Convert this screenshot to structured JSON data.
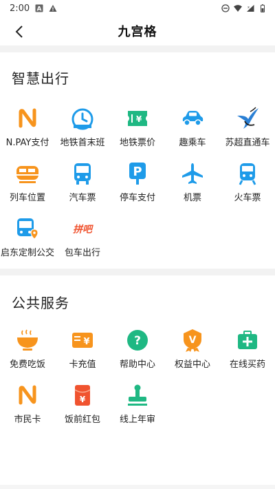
{
  "status_bar": {
    "time": "2:00"
  },
  "header": {
    "title": "九宫格"
  },
  "sections": [
    {
      "title": "智慧出行",
      "items": [
        {
          "label": "N.PAY支付",
          "icon": "npay-icon"
        },
        {
          "label": "地铁首末班",
          "icon": "subway-clock-icon"
        },
        {
          "label": "地铁票价",
          "icon": "subway-ticket-icon"
        },
        {
          "label": "趣乘车",
          "icon": "car-icon"
        },
        {
          "label": "苏超直通车",
          "icon": "swallow-logo-icon"
        },
        {
          "label": "列车位置",
          "icon": "train-location-icon"
        },
        {
          "label": "汽车票",
          "icon": "bus-ticket-icon"
        },
        {
          "label": "停车支付",
          "icon": "parking-icon"
        },
        {
          "label": "机票",
          "icon": "airplane-icon"
        },
        {
          "label": "火车票",
          "icon": "train-icon"
        },
        {
          "label": "启东定制公交",
          "icon": "custom-bus-icon"
        },
        {
          "label": "包车出行",
          "icon": "charter-icon",
          "icon_text": "拼吧"
        }
      ]
    },
    {
      "title": "公共服务",
      "items": [
        {
          "label": "免费吃饭",
          "icon": "rice-bowl-icon"
        },
        {
          "label": "卡充值",
          "icon": "card-recharge-icon",
          "icon_text": "¥"
        },
        {
          "label": "帮助中心",
          "icon": "help-icon",
          "icon_text": "?"
        },
        {
          "label": "权益中心",
          "icon": "badge-icon",
          "icon_text": "V"
        },
        {
          "label": "在线买药",
          "icon": "medicine-kit-icon"
        },
        {
          "label": "市民卡",
          "icon": "citizen-card-icon"
        },
        {
          "label": "饭前红包",
          "icon": "red-packet-icon",
          "icon_text": "¥"
        },
        {
          "label": "线上年审",
          "icon": "stamp-icon"
        }
      ]
    }
  ],
  "colors": {
    "orange": "#f7941d",
    "blue": "#1e9be9",
    "green": "#1fb883",
    "red": "#f0532f"
  }
}
